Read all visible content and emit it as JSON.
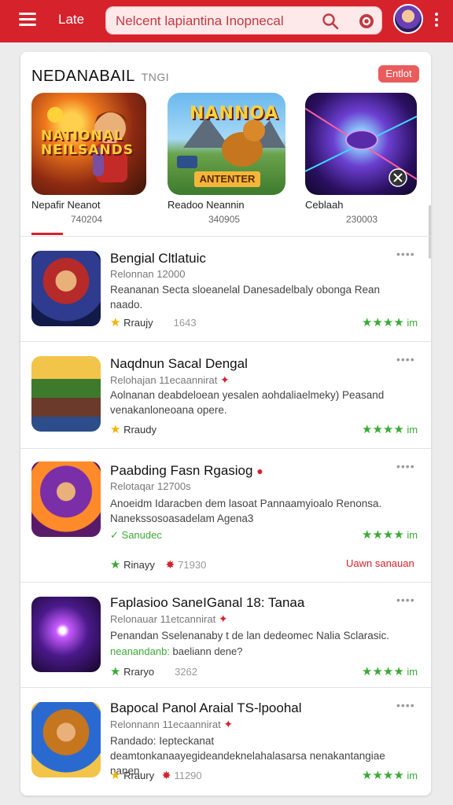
{
  "header": {
    "brand": "Late",
    "search_value": "Nelcent lapiantina Inopnecal",
    "icons": [
      "menu-icon",
      "search-icon",
      "mic-icon",
      "avatar",
      "more-vert-icon"
    ],
    "accent": "#d6222b"
  },
  "featured": {
    "title": "NEDANABAIL",
    "subtitle": "TNGI",
    "action_label": "Entlot",
    "items": [
      {
        "art_text": "NATIONAL\nNEILSANDS",
        "name": "Nepafir Neanot",
        "count": "740204"
      },
      {
        "art_text": "NANNOA",
        "banner": "ANTENTER",
        "name": "Readoo Neannin",
        "count": "340905"
      },
      {
        "art_text": "",
        "name": "Ceblaah",
        "count": "230003"
      }
    ]
  },
  "list": [
    {
      "title": "Bengial Cltlatuic",
      "developer": "Relonnan 12000",
      "description": "Reananan Secta sloeanelal Danesadelbaly obonga Rean naado.",
      "meta_label": "Rraujy",
      "meta_value": "1643",
      "rating": "im",
      "more": "••••"
    },
    {
      "title": "Naqdnun Sacal Dengal",
      "developer": "Relohajan 11ecaannirat",
      "description": "Aolnanan deabdeloean yesalen aohdaliaelmeky) Peasand venakanloneoana opere.",
      "meta_label": "Rraudy",
      "meta_value": "",
      "rating": "im",
      "more": "••••"
    },
    {
      "title": "Paabding Fasn Rgasiog",
      "developer": "Relotaqar 12700s",
      "description": "Anoeidm Idaracben dem lasoat Pannaamyioalo Renonsa. Nanekssosoasadelam Agena3",
      "green_label": "Sanudec",
      "meta_label": "Rinayy",
      "meta_value": "71930",
      "rating": "im",
      "link_label": "Uawn sanauan",
      "more": "••••"
    },
    {
      "title": "Faplasioo SaneIGanal 18: Tanaa",
      "developer": "Relonauar 11etcannirat",
      "description": "Penandan Sselenanaby t de lan dedeomec Nalia Sclarasic.",
      "green_label": "neanandanb:",
      "desc_tail": "baeliann dene?",
      "meta_label": "Rraryo",
      "meta_value": "3262",
      "rating": "im",
      "more": "••••"
    },
    {
      "title": "Bapocal Panol Araial  TS-lpoohal",
      "developer": "Relonnann 11ecaannirat",
      "description": "Randado: Iepteckanat deamtonkanaayegideandeknelahalasarsa nenakantangiae nanen.",
      "meta_label": "Rraury",
      "meta_value": "11290",
      "rating": "im",
      "more": "••••"
    }
  ]
}
